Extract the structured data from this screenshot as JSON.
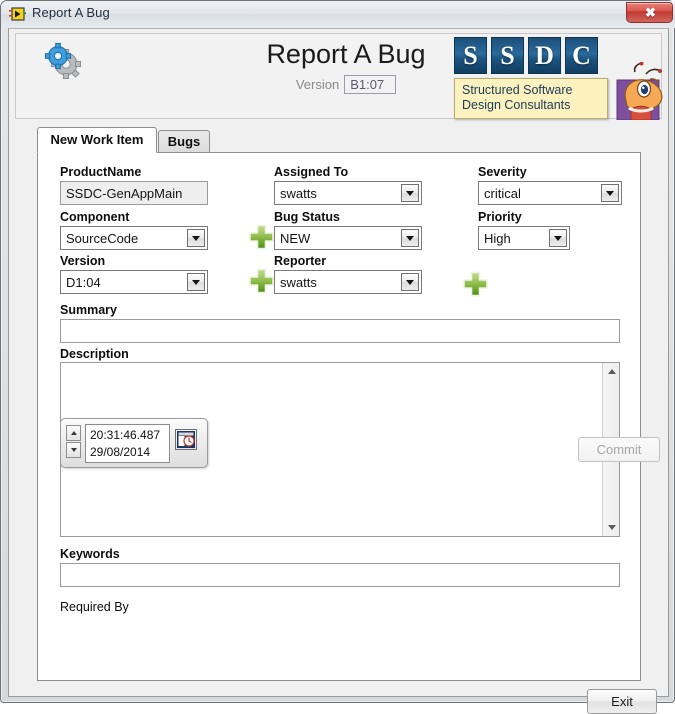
{
  "window": {
    "title": "Report A Bug",
    "icon": "labview-vi-icon",
    "close_label": "✖"
  },
  "header": {
    "gear_icon": "gears-icon",
    "app_title": "Report A Bug",
    "version_label": "Version",
    "version_value": "B1:07",
    "logo": {
      "letters": [
        "S",
        "S",
        "D",
        "C"
      ],
      "tagline_line1": "Structured Software",
      "tagline_line2": "Design Consultants",
      "square_color": "#1d4f79",
      "tagline_bg": "#fbf2c0"
    },
    "mascot": "bug-mascot-icon"
  },
  "tabs": [
    {
      "label": "New Work Item",
      "active": true
    },
    {
      "label": "Bugs",
      "active": false
    }
  ],
  "form": {
    "product_name": {
      "label": "ProductName",
      "value": "SSDC-GenAppMain",
      "readonly": true
    },
    "component": {
      "label": "Component",
      "value": "SourceCode"
    },
    "version": {
      "label": "Version",
      "value": "D1:04"
    },
    "assigned_to": {
      "label": "Assigned To",
      "value": "swatts"
    },
    "bug_status": {
      "label": "Bug Status",
      "value": "NEW"
    },
    "reporter": {
      "label": "Reporter",
      "value": "swatts"
    },
    "severity": {
      "label": "Severity",
      "value": "critical"
    },
    "priority": {
      "label": "Priority",
      "value": "High"
    },
    "summary": {
      "label": "Summary",
      "value": ""
    },
    "description": {
      "label": "Description",
      "value": ""
    },
    "keywords": {
      "label": "Keywords",
      "value": ""
    },
    "required_by": {
      "label": "Required By",
      "time": "20:31:46.487",
      "date": "29/08/2014",
      "calendar_icon": "calendar-clock-icon"
    },
    "add_buttons": [
      "add-component-button",
      "add-version-button",
      "add-reporter-button"
    ],
    "plus_color": "#76a83a"
  },
  "buttons": {
    "commit": {
      "label": "Commit",
      "enabled": false
    },
    "exit": {
      "label": "Exit",
      "enabled": true
    }
  }
}
